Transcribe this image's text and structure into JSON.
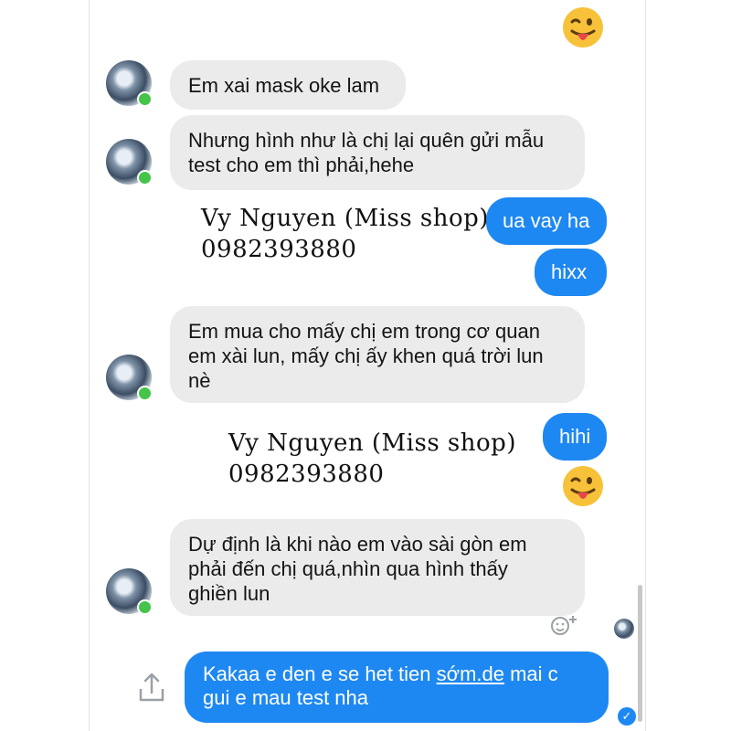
{
  "messages": {
    "m1": "Em xai mask oke lam",
    "m2_line1": "Nhưng hình như là chị lại quên gửi mẫu",
    "m2_line2": "test cho em thì phải,hehe",
    "m3": "ua vay ha",
    "m4": "hixx",
    "m5_line1": "Em mua cho mấy chị em trong cơ quan",
    "m5_line2": "em xài lun, mấy chị ấy khen quá trời lun",
    "m5_line3": "nè",
    "m6": "hihi",
    "m7_line1": "Dự định là khi nào em vào sài gòn em",
    "m7_line2": "phải đến chị quá,nhìn qua hình thấy",
    "m7_line3": "ghiền lun",
    "m8_part1": "Kakaa e den e se het tien ",
    "m8_link": "sớm.de",
    "m8_part2": " mai c",
    "m8_line2": "gui e mau test nha"
  },
  "watermark": {
    "name": "Vy Nguyen (Miss shop)",
    "phone": "0982393880"
  },
  "icons": {
    "emoji": "tongue-out-emoji",
    "react": "add-reaction-icon",
    "share": "share-icon",
    "check": "delivered-check-icon"
  },
  "colors": {
    "outgoing": "#1e88f2",
    "incoming": "#ebebeb",
    "online": "#44c448"
  }
}
